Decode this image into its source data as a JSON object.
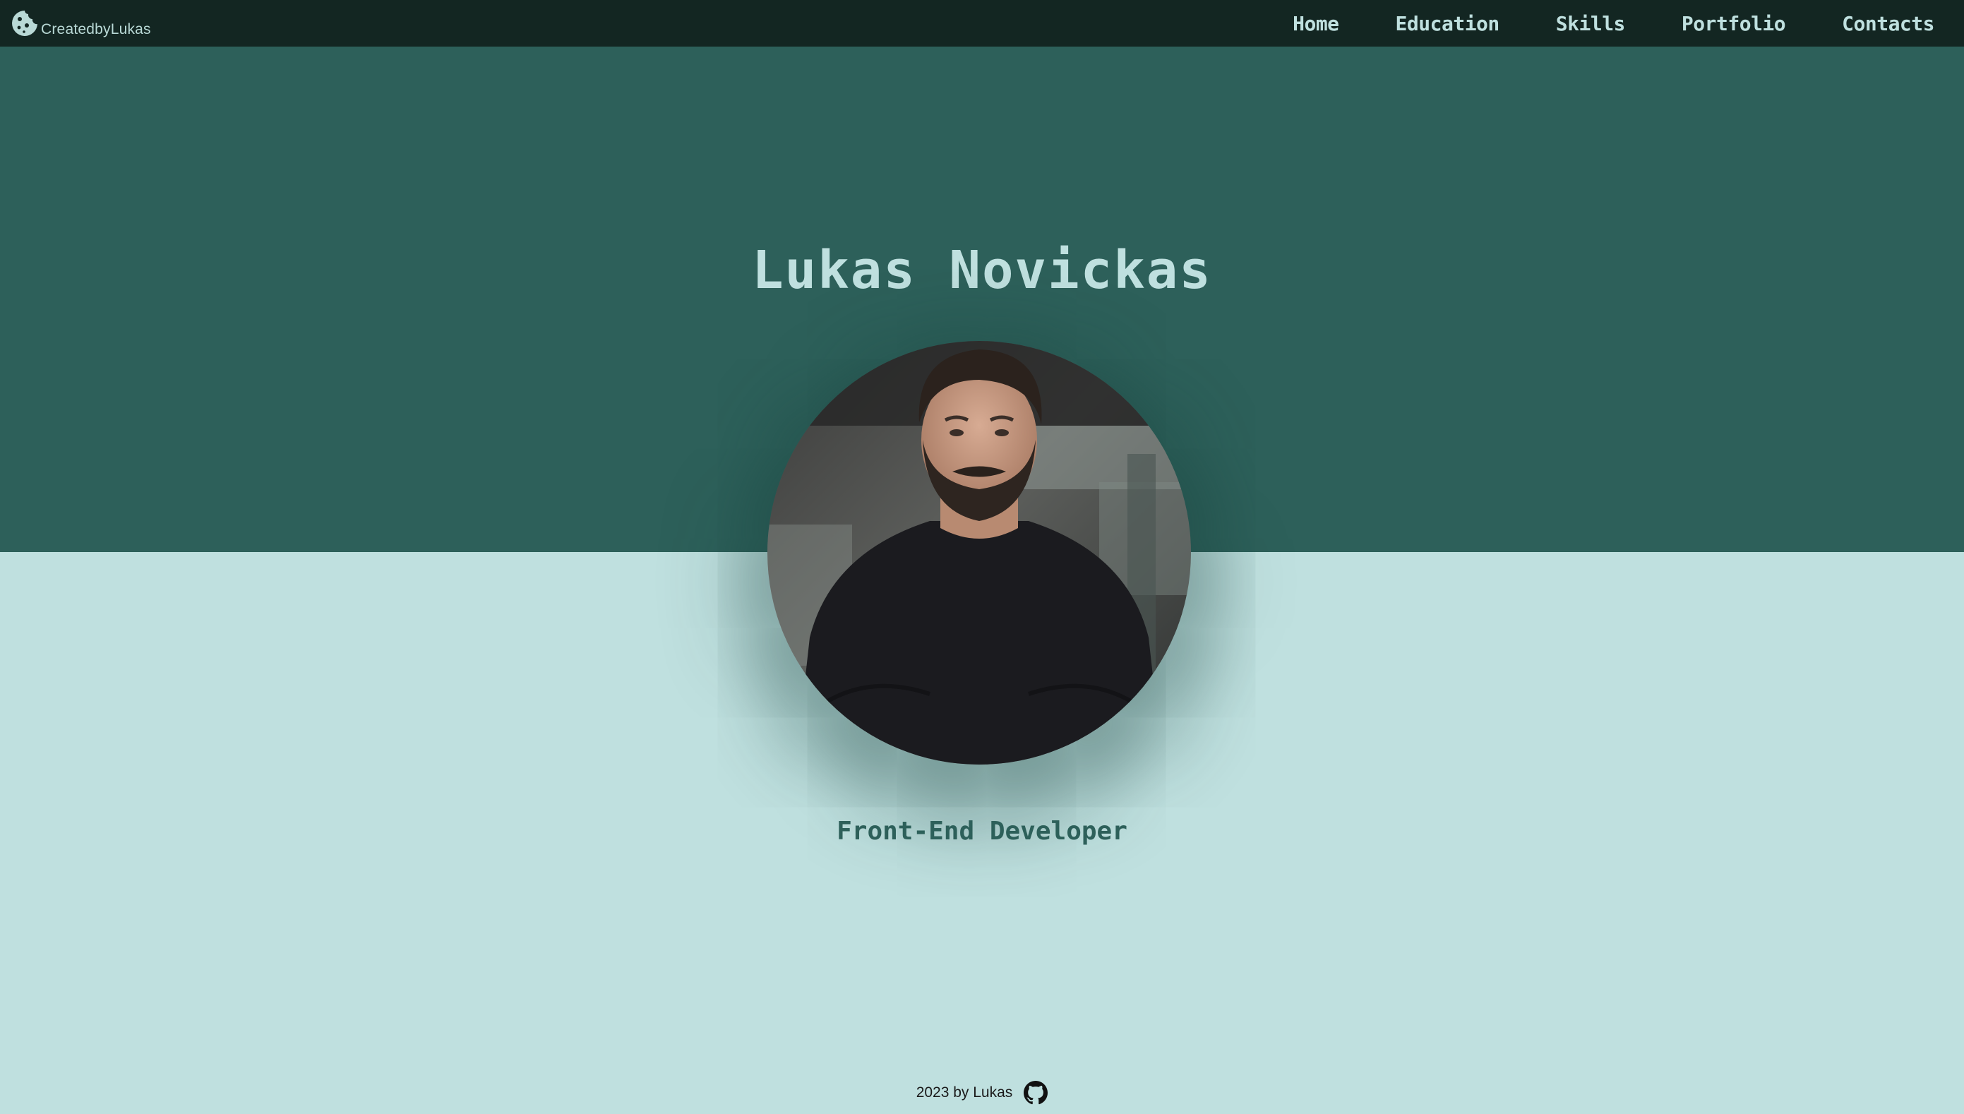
{
  "nav": {
    "brand_icon": "cookie-icon",
    "brand_label": "CreatedbyLukas",
    "links": [
      {
        "label": "Home"
      },
      {
        "label": "Education"
      },
      {
        "label": "Skills"
      },
      {
        "label": "Portfolio"
      },
      {
        "label": "Contacts"
      }
    ]
  },
  "hero": {
    "name": "Lukas Novickas",
    "subtitle": "Front-End Developer",
    "photo_alt": "Lukas Novickas"
  },
  "footer": {
    "text": "2023 by Lukas",
    "icon": "github-icon"
  },
  "colors": {
    "nav_bg": "#132622",
    "hero_top_bg": "#2d605a",
    "hero_bottom_bg": "#bfe0df",
    "text_light": "#bfe0df",
    "text_dark": "#2d605a"
  }
}
